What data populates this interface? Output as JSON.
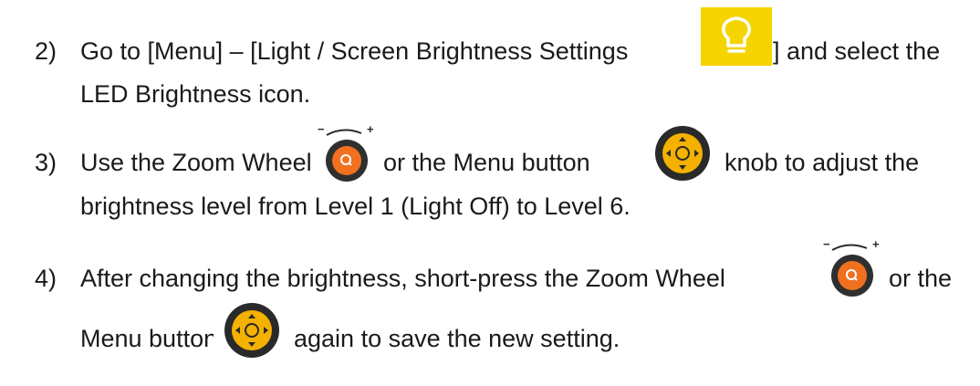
{
  "steps": [
    {
      "number": "2)",
      "line1_a": "Go to [Menu] – [Light / Screen Brightness Settings",
      "line1_b": "] and select the",
      "line2": "LED Brightness icon.",
      "icon": "lightbulb-icon"
    },
    {
      "number": "3)",
      "line1_a": "Use the Zoom Wheel",
      "line1_b": "or the Menu button",
      "line1_c": "knob to adjust the",
      "line2": "brightness level from Level 1 (Light Off) to Level 6.",
      "icons": [
        "zoom-wheel-icon",
        "menu-button-icon"
      ],
      "wheel_minus": "−",
      "wheel_plus": "+"
    },
    {
      "number": "4)",
      "line1_a": "After changing the brightness, short-press the Zoom Wheel",
      "line1_b": "or the",
      "line2_a": "Menu button",
      "line2_b": "again to save the new setting.",
      "icons": [
        "zoom-wheel-icon",
        "menu-button-icon"
      ],
      "wheel_minus": "−",
      "wheel_plus": "+"
    }
  ],
  "colors": {
    "bulb_bg": "#f5d400",
    "wheel_orange": "#f07020",
    "button_yellow": "#f5b100",
    "dark": "#2a2a2a",
    "text": "#1a1a1a"
  }
}
